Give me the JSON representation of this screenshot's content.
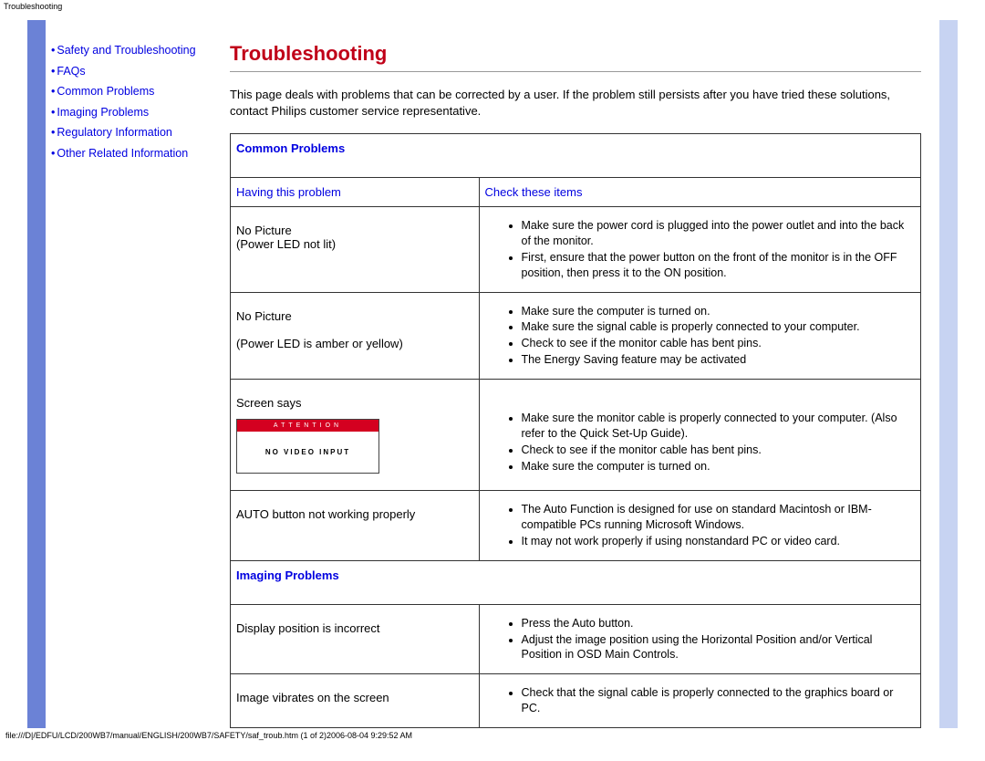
{
  "top_label": "Troubleshooting",
  "sidebar": {
    "items": [
      {
        "label": "Safety and Troubleshooting",
        "multiline": true
      },
      {
        "label": "FAQs"
      },
      {
        "label": "Common Problems"
      },
      {
        "label": "Imaging Problems"
      },
      {
        "label": "Regulatory Information"
      },
      {
        "label": "Other Related Information"
      }
    ]
  },
  "main": {
    "heading": "Troubleshooting",
    "intro": "This page deals with problems that can be corrected by a user. If the problem still persists after you have tried these solutions, contact Philips customer service representative.",
    "col_problem": "Having this problem",
    "col_check": "Check these items",
    "section_common": "Common Problems",
    "section_imaging": "Imaging Problems",
    "rows": [
      {
        "problem_lines": [
          "No Picture",
          "(Power LED not lit)"
        ],
        "checks": [
          "Make sure the power cord is plugged into the power outlet and into the back of the monitor.",
          "First, ensure that the power button on the front of the monitor is in the OFF position, then press it to the ON position."
        ]
      },
      {
        "problem_lines": [
          "No Picture",
          "",
          "(Power LED is amber or yellow)"
        ],
        "checks": [
          "Make sure the computer is turned on.",
          "Make sure the signal cable is properly connected to your computer.",
          "Check to see if the monitor cable has bent pins.",
          "The Energy Saving feature may be activated"
        ]
      },
      {
        "problem_lines": [
          "Screen says"
        ],
        "has_attention_box": true,
        "attention_title": "ATTENTION",
        "attention_body": "NO VIDEO INPUT",
        "checks": [
          "Make sure the monitor cable is properly connected to your computer. (Also refer to the Quick Set-Up Guide).",
          "Check to see if the monitor cable has bent pins.",
          "Make sure the computer is turned on."
        ]
      },
      {
        "problem_lines": [
          "AUTO button not working properly"
        ],
        "checks": [
          "The Auto Function is designed for use on standard Macintosh or IBM-compatible PCs running Microsoft Windows.",
          "It may not work properly if using nonstandard PC or video card."
        ]
      }
    ],
    "imaging_rows": [
      {
        "problem_lines": [
          "Display position is incorrect"
        ],
        "checks": [
          "Press the Auto button.",
          "Adjust the image position using the Horizontal Position and/or Vertical Position in OSD Main Controls."
        ]
      },
      {
        "problem_lines": [
          "Image vibrates on the screen"
        ],
        "checks": [
          "Check that the signal cable is properly connected to the graphics board or PC."
        ]
      }
    ]
  },
  "footer": "file:///D|/EDFU/LCD/200WB7/manual/ENGLISH/200WB7/SAFETY/saf_troub.htm (1 of 2)2006-08-04 9:29:52 AM"
}
